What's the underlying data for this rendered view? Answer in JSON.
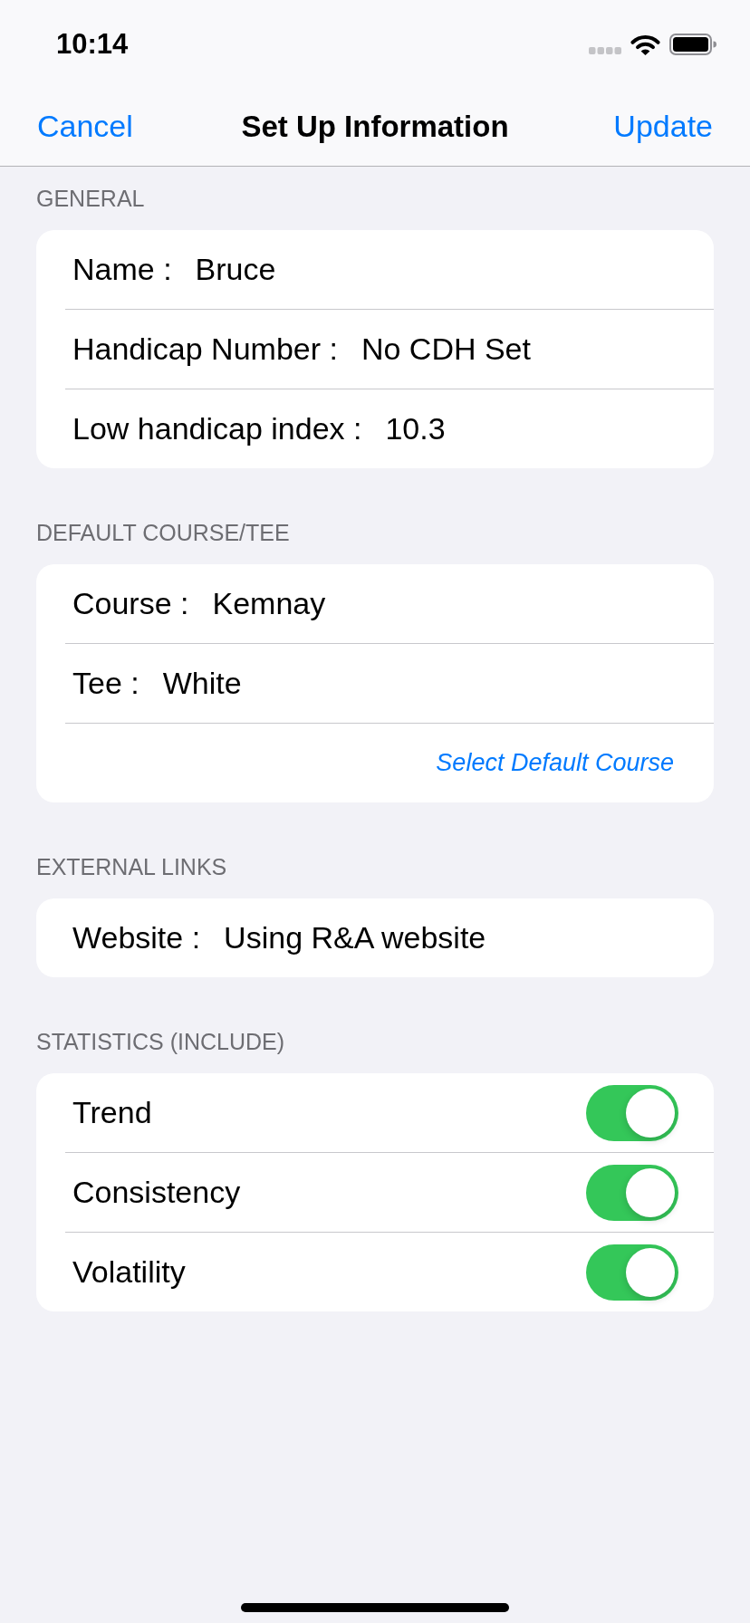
{
  "status_bar": {
    "time": "10:14"
  },
  "nav_bar": {
    "left_button": "Cancel",
    "title": "Set Up Information",
    "right_button": "Update"
  },
  "sections": [
    {
      "header": "GENERAL",
      "rows": [
        {
          "kind": "field",
          "label": "Name :",
          "value": "Bruce"
        },
        {
          "kind": "field",
          "label": "Handicap Number :",
          "value": "No CDH Set"
        },
        {
          "kind": "field",
          "label": "Low handicap index :",
          "value": "10.3"
        }
      ]
    },
    {
      "header": "DEFAULT COURSE/TEE",
      "rows": [
        {
          "kind": "field",
          "label": "Course :",
          "value": "Kemnay"
        },
        {
          "kind": "field",
          "label": "Tee :",
          "value": "White"
        },
        {
          "kind": "link",
          "label": "Select Default Course"
        }
      ]
    },
    {
      "header": "EXTERNAL LINKS",
      "rows": [
        {
          "kind": "field",
          "label": "Website :",
          "value": "Using R&A website"
        }
      ]
    },
    {
      "header": "STATISTICS (INCLUDE)",
      "rows": [
        {
          "kind": "toggle",
          "label": "Trend",
          "on": true
        },
        {
          "kind": "toggle",
          "label": "Consistency",
          "on": true
        },
        {
          "kind": "toggle",
          "label": "Volatility",
          "on": true
        }
      ]
    }
  ]
}
